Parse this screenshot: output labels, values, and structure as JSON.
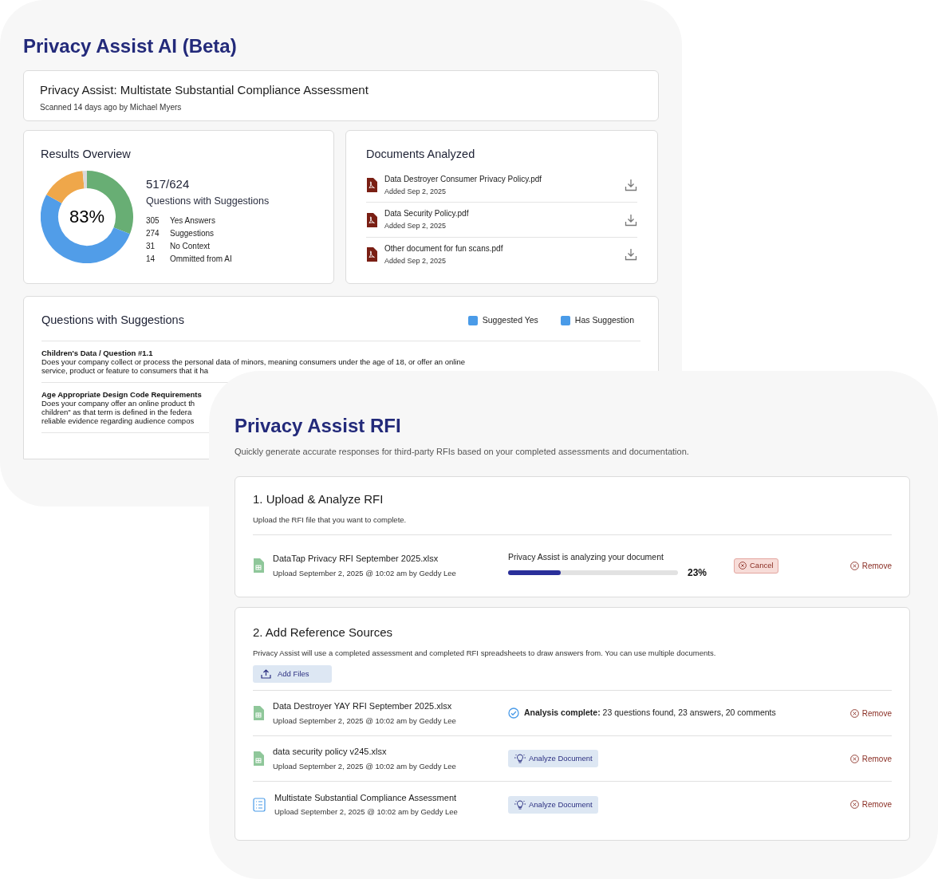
{
  "assessment_panel": {
    "title": "Privacy Assist AI (Beta)",
    "header": {
      "title": "Privacy Assist: Multistate Substantial Compliance Assessment",
      "subtitle": "Scanned 14 days ago by Michael Myers"
    },
    "results": {
      "title": "Results Overview",
      "percent": "83%",
      "ratio": "517/624",
      "ratio_label": "Questions with Suggestions",
      "stats": [
        {
          "count": "305",
          "label": "Yes Answers"
        },
        {
          "count": "274",
          "label": "Suggestions"
        },
        {
          "count": "31",
          "label": "No Context"
        },
        {
          "count": "14",
          "label": "Ommitted from AI"
        }
      ]
    },
    "documents": {
      "title": "Documents Analyzed",
      "items": [
        {
          "name": "Data Destroyer Consumer Privacy Policy.pdf",
          "date": "Added Sep 2, 2025"
        },
        {
          "name": "Data Security Policy.pdf",
          "date": "Added Sep 2, 2025"
        },
        {
          "name": "Other document for fun scans.pdf",
          "date": "Added Sep 2, 2025"
        }
      ]
    },
    "questions": {
      "title": "Questions with Suggestions",
      "legend": [
        {
          "label": "Suggested Yes",
          "color": "#4a9be8"
        },
        {
          "label": "Has Suggestion",
          "color": "#4a9be8"
        }
      ],
      "items": [
        {
          "heading": "Children's Data / Question #1.1",
          "lines": [
            "Does your company collect or process the personal data of minors, meaning consumers under the age of 18, or offer an online",
            "service, product or feature to consumers that it ha"
          ]
        },
        {
          "heading": "Age Appropriate Design Code Requirements",
          "lines": [
            "Does your company offer an online product th",
            "children\" as that term is defined in the federa",
            "reliable evidence regarding audience compos"
          ]
        }
      ]
    }
  },
  "rfi_panel": {
    "title": "Privacy Assist RFI",
    "subtitle": "Quickly generate accurate responses for third-party RFIs based on your completed assessments and documentation.",
    "upload": {
      "title": "1. Upload & Analyze RFI",
      "description": "Upload the RFI file that you want to complete.",
      "file": {
        "name": "DataTap Privacy RFI September 2025.xlsx",
        "meta": "Upload September 2, 2025 @ 10:02 am by Geddy Lee",
        "progress_label": "Privacy Assist is analyzing your document",
        "level": 0.31,
        "reading": "23%",
        "cancel": "Cancel",
        "remove": "Remove"
      }
    },
    "sources": {
      "title": "2. Add Reference Sources",
      "description": "Privacy Assist will use a completed assessment and completed RFI spreadsheets to draw answers from. You can use multiple documents.",
      "add_button": "Add Files",
      "items": [
        {
          "kind": "spreadsheet",
          "name": "Data Destroyer YAY RFI September 2025.xlsx",
          "meta": "Upload September 2, 2025 @ 10:02 am by Geddy Lee",
          "status": {
            "kind": "complete",
            "text": "**Analysis complete:** 23 questions found, 23 answers, 20 comments"
          },
          "remove": "Remove"
        },
        {
          "kind": "spreadsheet",
          "name": "data security policy v245.xlsx",
          "meta": "Upload September 2, 2025 @ 10:02 am by Geddy Lee",
          "status": {
            "kind": "action",
            "text": "Analyze Document"
          },
          "remove": "Remove"
        },
        {
          "kind": "checklist",
          "name": "Multistate Substantial Compliance Assessment",
          "meta": "Upload September 2, 2025 @ 10:02 am by Geddy Lee",
          "status": {
            "kind": "action",
            "text": "Analyze Document"
          },
          "remove": "Remove"
        }
      ]
    }
  }
}
